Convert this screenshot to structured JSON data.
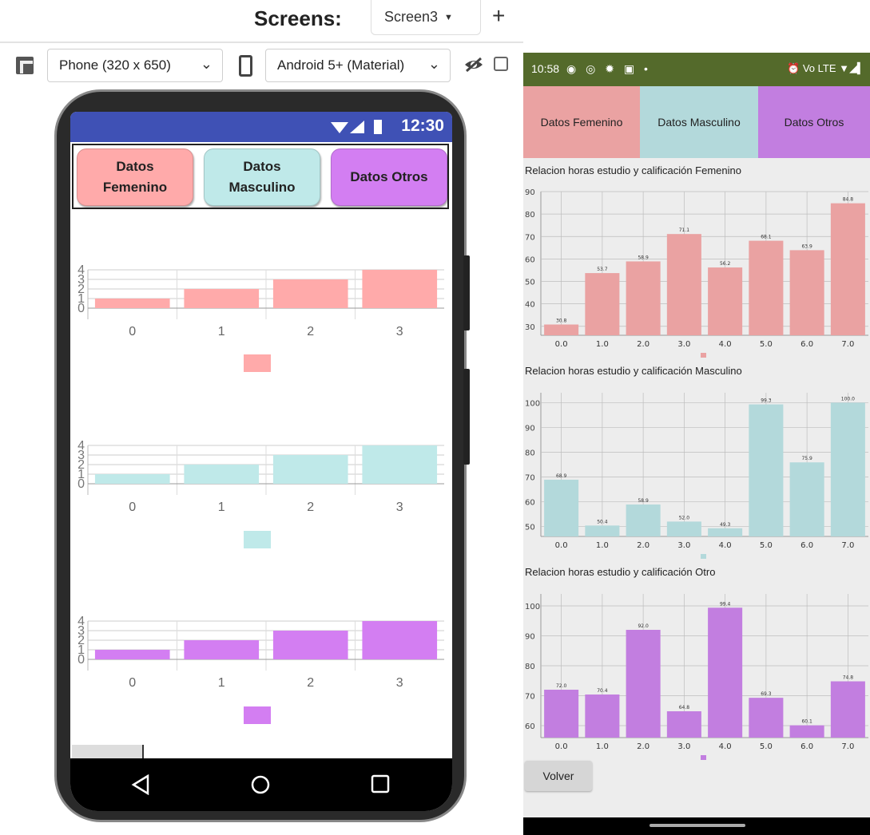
{
  "designer": {
    "screens_label": "Screens:",
    "screen_selected": "Screen3",
    "add_label": "+",
    "device_size": "Phone (320 x 650)",
    "theme": "Android 5+ (Material)"
  },
  "phone": {
    "time": "12:30",
    "buttons": [
      {
        "label_line1": "Datos",
        "label_line2": "Femenino",
        "color": "#ffaaaa"
      },
      {
        "label_line1": "Datos",
        "label_line2": "Masculino",
        "color": "#bfe9e9"
      },
      {
        "label_line1": "Datos Otros",
        "label_line2": "",
        "color": "#d37ef2"
      }
    ],
    "chart_data": [
      {
        "type": "bar",
        "categories": [
          "0",
          "1",
          "2",
          "3"
        ],
        "values": [
          1,
          2,
          3,
          4
        ],
        "yticks": [
          "0",
          "1",
          "2",
          "3",
          "4"
        ],
        "ylim": [
          0,
          4
        ],
        "color": "#ffaaaa"
      },
      {
        "type": "bar",
        "categories": [
          "0",
          "1",
          "2",
          "3"
        ],
        "values": [
          1,
          2,
          3,
          4
        ],
        "yticks": [
          "0",
          "1",
          "2",
          "3",
          "4"
        ],
        "ylim": [
          0,
          4
        ],
        "color": "#bfe9e9"
      },
      {
        "type": "bar",
        "categories": [
          "0",
          "1",
          "2",
          "3"
        ],
        "values": [
          1,
          2,
          3,
          4
        ],
        "yticks": [
          "0",
          "1",
          "2",
          "3",
          "4"
        ],
        "ylim": [
          0,
          4
        ],
        "color": "#d37ef2"
      }
    ]
  },
  "device": {
    "time": "10:58",
    "status_left_icons": "◉ ◎ ✹ ▣ •",
    "status_right_icons": "⏰ Vo LTE ▼◢▍",
    "tabs": [
      {
        "label": "Datos Femenino",
        "color": "#eaa2a2"
      },
      {
        "label": "Datos Masculino",
        "color": "#b3d9db"
      },
      {
        "label": "Datos Otros",
        "color": "#c27ee0"
      }
    ],
    "volver_label": "Volver",
    "chart_data": [
      {
        "type": "bar",
        "title": "Relacion horas estudio y calificación Femenino",
        "categories": [
          "0.0",
          "1.0",
          "2.0",
          "3.0",
          "4.0",
          "5.0",
          "6.0",
          "7.0"
        ],
        "values": [
          30.8,
          53.7,
          58.9,
          71.1,
          56.2,
          68.1,
          63.9,
          84.8
        ],
        "value_labels": [
          "30.8",
          "53.7",
          "58.9",
          "71.1",
          "56.2",
          "68.1",
          "63.9",
          "84.8"
        ],
        "yticks": [
          "30",
          "40",
          "50",
          "60",
          "70",
          "80",
          "90"
        ],
        "ylim": [
          26,
          90
        ],
        "color": "#eaa2a2"
      },
      {
        "type": "bar",
        "title": "Relacion horas estudio y calificación Masculino",
        "categories": [
          "0.0",
          "1.0",
          "2.0",
          "3.0",
          "4.0",
          "5.0",
          "6.0",
          "7.0"
        ],
        "values": [
          68.9,
          50.4,
          58.9,
          52.0,
          49.3,
          99.3,
          75.9,
          100.0
        ],
        "value_labels": [
          "68.9",
          "50.4",
          "58.9",
          "52.0",
          "49.3",
          "99.3",
          "75.9",
          "100.0"
        ],
        "yticks": [
          "50",
          "60",
          "70",
          "80",
          "90",
          "100"
        ],
        "ylim": [
          46,
          104
        ],
        "color": "#b3d9db"
      },
      {
        "type": "bar",
        "title": "Relacion horas estudio y calificación Otro",
        "categories": [
          "0.0",
          "1.0",
          "2.0",
          "3.0",
          "4.0",
          "5.0",
          "6.0",
          "7.0"
        ],
        "values": [
          72.0,
          70.4,
          92.0,
          64.8,
          99.4,
          69.3,
          60.1,
          74.8
        ],
        "value_labels": [
          "72.0",
          "70.4",
          "92.0",
          "64.8",
          "99.4",
          "69.3",
          "60.1",
          "74.8"
        ],
        "yticks": [
          "60",
          "70",
          "80",
          "90",
          "100"
        ],
        "ylim": [
          56,
          104
        ],
        "color": "#c27ee0"
      }
    ]
  }
}
